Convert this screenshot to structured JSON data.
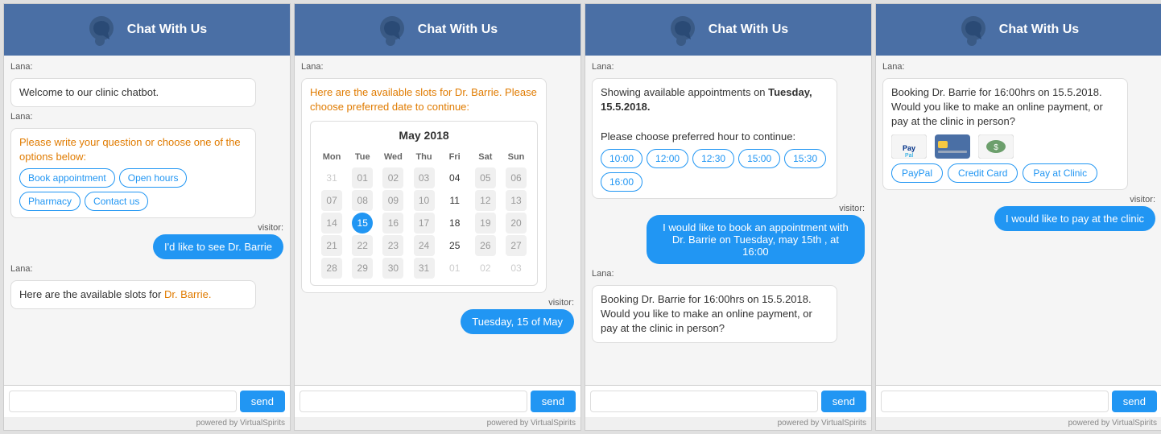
{
  "widgets": [
    {
      "id": "widget1",
      "header": {
        "title": "Chat With Us"
      },
      "messages": [
        {
          "sender": "lana",
          "type": "text",
          "text": "Welcome to our clinic chatbot."
        },
        {
          "sender": "lana",
          "type": "options",
          "text": "Please write your question or choose one of the options below:",
          "options": [
            "Book appointment",
            "Open hours",
            "Pharmacy",
            "Contact us"
          ]
        },
        {
          "sender": "visitor",
          "type": "text",
          "text": "I'd like to see Dr. Barrie"
        },
        {
          "sender": "lana",
          "type": "text",
          "text": "Here are the available slots for Dr. Barrie."
        }
      ],
      "input": {
        "placeholder": "",
        "send_label": "send"
      },
      "powered_by": "powered by VirtualSpirits"
    },
    {
      "id": "widget2",
      "header": {
        "title": "Chat With Us"
      },
      "messages": [
        {
          "sender": "lana",
          "type": "calendar",
          "text": "Here are the available slots for Dr. Barrie. Please choose preferred date to continue:",
          "month": "May 2018"
        },
        {
          "sender": "visitor",
          "type": "text",
          "text": "Tuesday, 15 of May"
        }
      ],
      "calendar": {
        "month": "May 2018",
        "headers": [
          "Mon",
          "Tue",
          "Wed",
          "Thu",
          "Fri",
          "Sat",
          "Sun"
        ],
        "weeks": [
          [
            {
              "n": "31",
              "type": "other"
            },
            {
              "n": "01",
              "type": "unavail"
            },
            {
              "n": "02",
              "type": "unavail"
            },
            {
              "n": "03",
              "type": "unavail"
            },
            {
              "n": "04",
              "type": "normal"
            },
            {
              "n": "05",
              "type": "unavail"
            },
            {
              "n": "06",
              "type": "unavail"
            }
          ],
          [
            {
              "n": "07",
              "type": "unavail"
            },
            {
              "n": "08",
              "type": "unavail"
            },
            {
              "n": "09",
              "type": "unavail"
            },
            {
              "n": "10",
              "type": "unavail"
            },
            {
              "n": "11",
              "type": "normal"
            },
            {
              "n": "12",
              "type": "unavail"
            },
            {
              "n": "13",
              "type": "unavail"
            }
          ],
          [
            {
              "n": "14",
              "type": "unavail"
            },
            {
              "n": "15",
              "type": "selected"
            },
            {
              "n": "16",
              "type": "unavail"
            },
            {
              "n": "17",
              "type": "unavail"
            },
            {
              "n": "18",
              "type": "normal"
            },
            {
              "n": "19",
              "type": "unavail"
            },
            {
              "n": "20",
              "type": "unavail"
            }
          ],
          [
            {
              "n": "21",
              "type": "unavail"
            },
            {
              "n": "22",
              "type": "unavail"
            },
            {
              "n": "23",
              "type": "unavail"
            },
            {
              "n": "24",
              "type": "unavail"
            },
            {
              "n": "25",
              "type": "normal"
            },
            {
              "n": "26",
              "type": "unavail"
            },
            {
              "n": "27",
              "type": "unavail"
            }
          ],
          [
            {
              "n": "28",
              "type": "unavail"
            },
            {
              "n": "29",
              "type": "unavail"
            },
            {
              "n": "30",
              "type": "unavail"
            },
            {
              "n": "31",
              "type": "unavail"
            },
            {
              "n": "01",
              "type": "other"
            },
            {
              "n": "02",
              "type": "other"
            },
            {
              "n": "03",
              "type": "other"
            }
          ]
        ]
      },
      "input": {
        "placeholder": "",
        "send_label": "send"
      },
      "powered_by": "powered by VirtualSpirits"
    },
    {
      "id": "widget3",
      "header": {
        "title": "Chat With Us"
      },
      "messages": [
        {
          "sender": "lana",
          "type": "timeslots",
          "intro": "Showing available appointments on ",
          "bold_part": "Tuesday, 15.5.2018.",
          "subtext": "Please choose preferred hour to continue:",
          "slots": [
            "10:00",
            "12:00",
            "12:30",
            "15:00",
            "15:30",
            "16:00"
          ]
        },
        {
          "sender": "visitor",
          "type": "text",
          "text": "I would like to book an appointment with Dr. Barrie on Tuesday, may 15th , at 16:00"
        },
        {
          "sender": "lana",
          "type": "text",
          "text": "Booking Dr. Barrie for 16:00hrs on 15.5.2018. Would you like to make an online payment, or pay at the clinic in person?"
        }
      ],
      "input": {
        "placeholder": "",
        "send_label": "send"
      },
      "powered_by": "powered by VirtualSpirits"
    },
    {
      "id": "widget4",
      "header": {
        "title": "Chat With Us"
      },
      "messages": [
        {
          "sender": "lana",
          "type": "payment",
          "text": "Booking Dr. Barrie for 16:00hrs on 15.5.2018. Would you like to make an online payment, or pay at the clinic in person?",
          "payment_options": [
            "PayPal",
            "Credit Card",
            "Pay at Clinic"
          ]
        },
        {
          "sender": "visitor",
          "type": "text",
          "text": "I would like to pay at the clinic"
        }
      ],
      "input": {
        "placeholder": "",
        "send_label": "send"
      },
      "powered_by": "powered by VirtualSpirits"
    }
  ]
}
